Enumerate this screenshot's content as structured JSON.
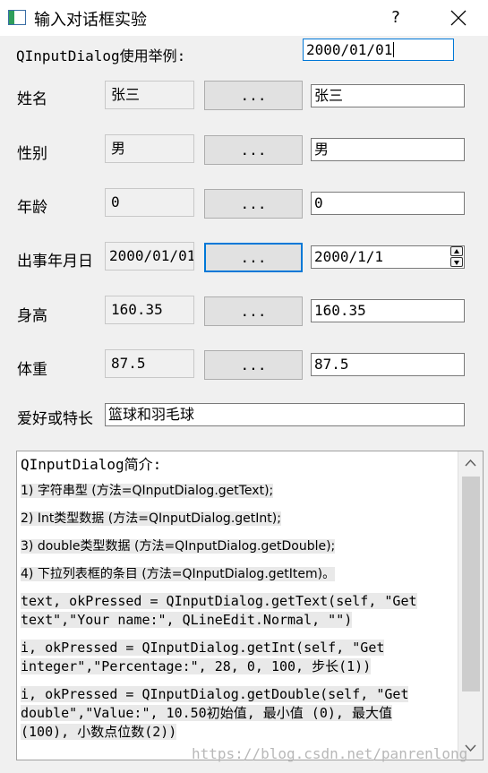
{
  "window": {
    "title": "输入对话框实验",
    "help_label": "?"
  },
  "header": {
    "example_label": "QInputDialog使用举例:",
    "date_input_value": "2000/01/01"
  },
  "rows": [
    {
      "label": "姓名",
      "display": "张三",
      "button": "...",
      "input": "张三"
    },
    {
      "label": "性别",
      "display": "男",
      "button": "...",
      "input": "男"
    },
    {
      "label": "年龄",
      "display": "0",
      "button": "...",
      "input": "0"
    },
    {
      "label": "出事年月日",
      "display": "2000/01/01",
      "button": "...",
      "input": "2000/1/1"
    },
    {
      "label": "身高",
      "display": "160.35",
      "button": "...",
      "input": "160.35"
    },
    {
      "label": "体重",
      "display": "87.5",
      "button": "...",
      "input": "87.5"
    }
  ],
  "hobby": {
    "label": "爱好或特长",
    "value": "篮球和羽毛球"
  },
  "intro": {
    "heading": "QInputDialog简介:",
    "paragraphs": [
      "1) 字符串型 (方法=QInputDialog.getText);",
      "2) Int类型数据 (方法=QInputDialog.getInt);",
      "3) double类型数据 (方法=QInputDialog.getDouble);",
      "4) 下拉列表框的条目 (方法=QInputDialog.getItem)。",
      "text, okPressed = QInputDialog.getText(self, \"Get text\",\"Your name:\", QLineEdit.Normal, \"\")",
      "i, okPressed = QInputDialog.getInt(self, \"Get integer\",\"Percentage:\", 28, 0, 100, 步长(1))",
      "i, okPressed = QInputDialog.getDouble(self, \"Get double\",\"Value:\", 10.50初始值, 最小值 (0), 最大值 (100), 小数点位数(2))"
    ]
  },
  "watermark": "https://blog.csdn.net/panrenlong"
}
